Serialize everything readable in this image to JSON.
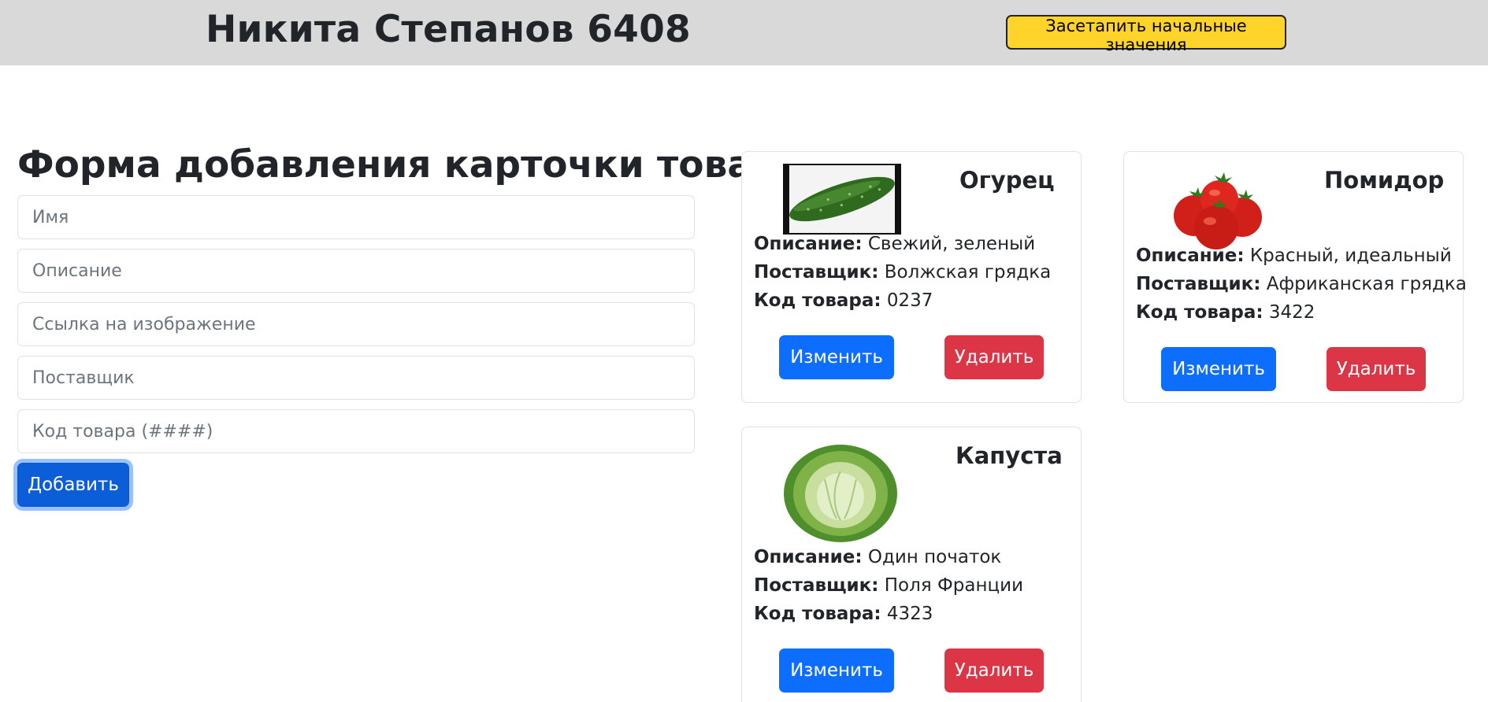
{
  "header": {
    "title": "Никита Степанов 6408",
    "reset_label": "Засетапить начальные значения"
  },
  "form": {
    "title": "Форма добавления карточки товаров",
    "fields": {
      "name_placeholder": "Имя",
      "description_placeholder": "Описание",
      "image_placeholder": "Ссылка на изображение",
      "supplier_placeholder": "Поставщик",
      "code_placeholder": "Код товара (####)"
    },
    "add_label": "Добавить"
  },
  "labels": {
    "description": "Описание:",
    "supplier": "Поставщик:",
    "code": "Код товара:",
    "edit": "Изменить",
    "delete": "Удалить"
  },
  "cards": [
    {
      "title": "Огурец",
      "description": "Свежий, зеленый",
      "supplier": "Волжская грядка",
      "code": "0237",
      "image": "cucumber-photo"
    },
    {
      "title": "Помидор",
      "description": "Красный, идеальный",
      "supplier": "Африканская грядка",
      "code": "3422",
      "image": "tomatoes-photo"
    },
    {
      "title": "Капуста",
      "description": "Один початок",
      "supplier": "Поля Франции",
      "code": "4323",
      "image": "cabbage-photo"
    }
  ],
  "colors": {
    "header_bg": "#d9d9d9",
    "reset_button": "#ffd42a",
    "primary": "#0d6efd",
    "danger": "#dc3545"
  }
}
